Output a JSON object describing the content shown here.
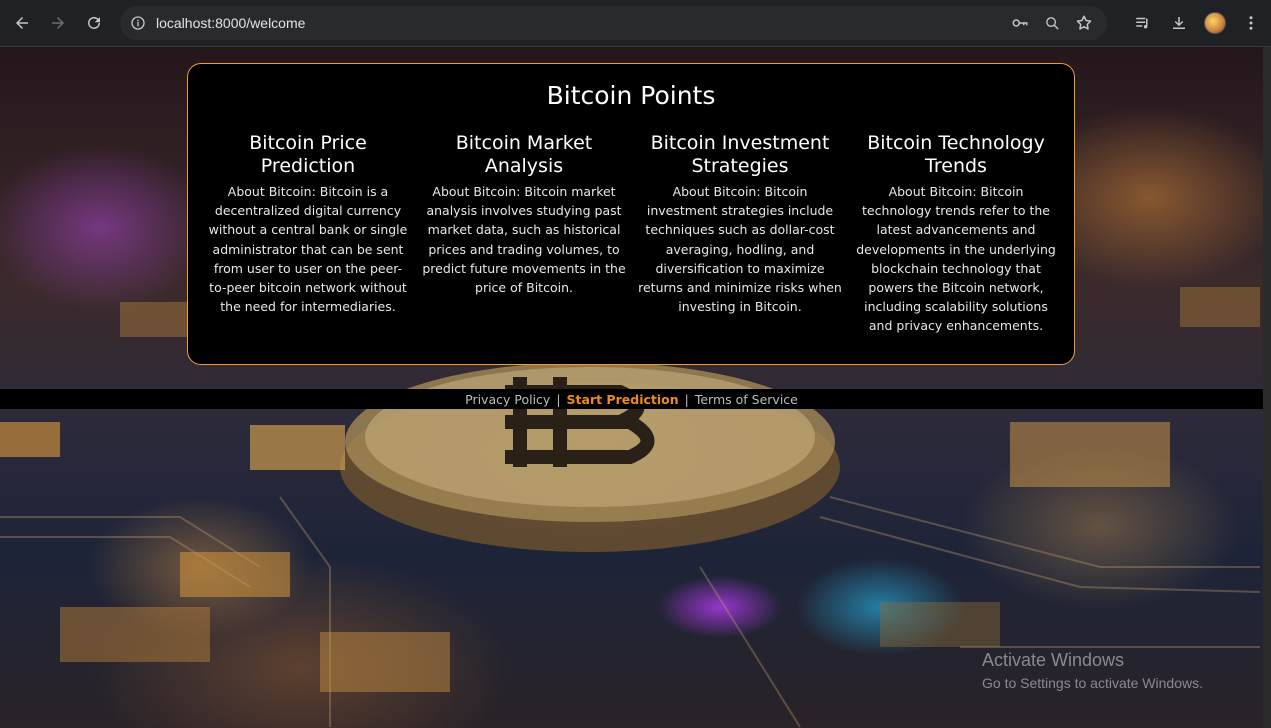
{
  "browser": {
    "url": "localhost:8000/welcome"
  },
  "card": {
    "title": "Bitcoin Points",
    "columns": [
      {
        "heading": "Bitcoin Price Prediction",
        "text": "About Bitcoin: Bitcoin is a decentralized digital currency without a central bank or single administrator that can be sent from user to user on the peer-to-peer bitcoin network without the need for intermediaries."
      },
      {
        "heading": "Bitcoin Market Analysis",
        "text": "About Bitcoin: Bitcoin market analysis involves studying past market data, such as historical prices and trading volumes, to predict future movements in the price of Bitcoin."
      },
      {
        "heading": "Bitcoin Investment Strategies",
        "text": "About Bitcoin: Bitcoin investment strategies include techniques such as dollar-cost averaging, hodling, and diversification to maximize returns and minimize risks when investing in Bitcoin."
      },
      {
        "heading": "Bitcoin Technology Trends",
        "text": "About Bitcoin: Bitcoin technology trends refer to the latest advancements and developments in the underlying blockchain technology that powers the Bitcoin network, including scalability solutions and privacy enhancements."
      }
    ]
  },
  "footer": {
    "privacy": "Privacy Policy",
    "separator": "|",
    "start": "Start Prediction",
    "terms": "Terms of Service"
  },
  "watermark": {
    "title": "Activate Windows",
    "subtitle": "Go to Settings to activate Windows."
  },
  "colors": {
    "accent": "#f08a1c",
    "card_border": "#f09b36"
  }
}
